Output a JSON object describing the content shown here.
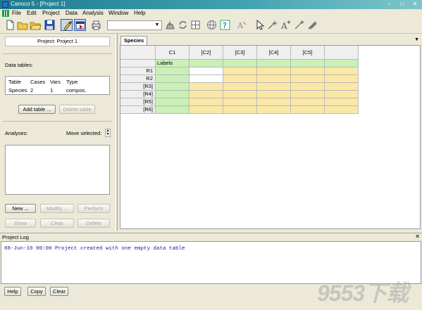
{
  "window": {
    "title": "Canoco 5 - [Project 1]",
    "controls": [
      "–",
      "□",
      "✕"
    ]
  },
  "menu": [
    "File",
    "Edit",
    "Project",
    "Data",
    "Analysis",
    "Window",
    "Help"
  ],
  "toolbar": {
    "icons": [
      "new-icon",
      "open-icon",
      "open-folder-icon",
      "save-icon",
      "edit-cells-icon",
      "pointer-mode-icon",
      "print-icon",
      "drop-icon",
      "refresh-icon",
      "layout-icon",
      "globe-icon",
      "help-icon",
      "pen-icon",
      "select-arrow-icon",
      "star-arrow-icon",
      "text-icon",
      "line-tool-icon",
      "edit-tool-icon"
    ],
    "combo_value": ""
  },
  "left_panel": {
    "project_label": "Project: Project 1",
    "data_tables_label": "Data tables:",
    "table": {
      "headers": [
        "Table",
        "Cases",
        "Vars",
        "Type"
      ],
      "rows": [
        [
          "Species",
          "2",
          "1",
          "compos."
        ]
      ]
    },
    "add_table_btn": "Add table ...",
    "delete_table_btn": "Delete table",
    "analyses_label": "Analyses:",
    "move_selected_label": "Move selected:",
    "buttons": [
      "New ...",
      "Modify ...",
      "Perform",
      "Show",
      "Clear",
      "Delete"
    ]
  },
  "sheet": {
    "tab": "Species",
    "columns": [
      "C1",
      "[C2]",
      "[C3]",
      "[C4]",
      "[C5]"
    ],
    "labels_header": "Labels",
    "rows": [
      "R1",
      "R2",
      "[R3]",
      "[R4]",
      "[R5]",
      "[R6]"
    ]
  },
  "log": {
    "title": "Project Log",
    "lines": [
      "08-Jun-10 00:00 Project created with one empty data table"
    ],
    "buttons": [
      "Help",
      "Copy",
      "Clear"
    ]
  },
  "watermark": "9553下载"
}
